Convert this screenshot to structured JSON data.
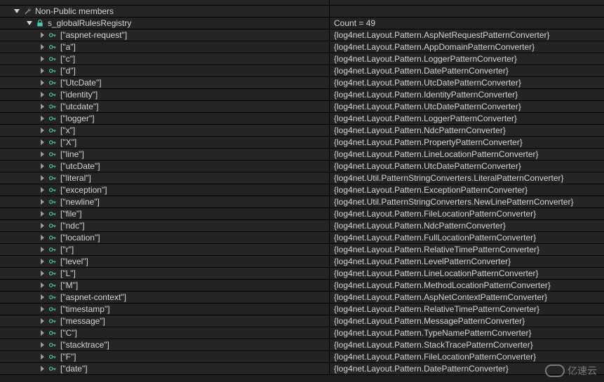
{
  "root": {
    "nonPublic": {
      "label": "Non-Public members",
      "registry": {
        "label": "s_globalRulesRegistry",
        "count_label": "Count = 49"
      }
    }
  },
  "entries": [
    {
      "key": "[\"aspnet-request\"]",
      "value": "{log4net.Layout.Pattern.AspNetRequestPatternConverter}"
    },
    {
      "key": "[\"a\"]",
      "value": "{log4net.Layout.Pattern.AppDomainPatternConverter}"
    },
    {
      "key": "[\"c\"]",
      "value": "{log4net.Layout.Pattern.LoggerPatternConverter}"
    },
    {
      "key": "[\"d\"]",
      "value": "{log4net.Layout.Pattern.DatePatternConverter}"
    },
    {
      "key": "[\"UtcDate\"]",
      "value": "{log4net.Layout.Pattern.UtcDatePatternConverter}"
    },
    {
      "key": "[\"identity\"]",
      "value": "{log4net.Layout.Pattern.IdentityPatternConverter}"
    },
    {
      "key": "[\"utcdate\"]",
      "value": "{log4net.Layout.Pattern.UtcDatePatternConverter}"
    },
    {
      "key": "[\"logger\"]",
      "value": "{log4net.Layout.Pattern.LoggerPatternConverter}"
    },
    {
      "key": "[\"x\"]",
      "value": "{log4net.Layout.Pattern.NdcPatternConverter}"
    },
    {
      "key": "[\"X\"]",
      "value": "{log4net.Layout.Pattern.PropertyPatternConverter}"
    },
    {
      "key": "[\"line\"]",
      "value": "{log4net.Layout.Pattern.LineLocationPatternConverter}"
    },
    {
      "key": "[\"utcDate\"]",
      "value": "{log4net.Layout.Pattern.UtcDatePatternConverter}"
    },
    {
      "key": "[\"literal\"]",
      "value": "{log4net.Util.PatternStringConverters.LiteralPatternConverter}"
    },
    {
      "key": "[\"exception\"]",
      "value": "{log4net.Layout.Pattern.ExceptionPatternConverter}"
    },
    {
      "key": "[\"newline\"]",
      "value": "{log4net.Util.PatternStringConverters.NewLinePatternConverter}"
    },
    {
      "key": "[\"file\"]",
      "value": "{log4net.Layout.Pattern.FileLocationPatternConverter}"
    },
    {
      "key": "[\"ndc\"]",
      "value": "{log4net.Layout.Pattern.NdcPatternConverter}"
    },
    {
      "key": "[\"location\"]",
      "value": "{log4net.Layout.Pattern.FullLocationPatternConverter}"
    },
    {
      "key": "[\"r\"]",
      "value": "{log4net.Layout.Pattern.RelativeTimePatternConverter}"
    },
    {
      "key": "[\"level\"]",
      "value": "{log4net.Layout.Pattern.LevelPatternConverter}"
    },
    {
      "key": "[\"L\"]",
      "value": "{log4net.Layout.Pattern.LineLocationPatternConverter}"
    },
    {
      "key": "[\"M\"]",
      "value": "{log4net.Layout.Pattern.MethodLocationPatternConverter}"
    },
    {
      "key": "[\"aspnet-context\"]",
      "value": "{log4net.Layout.Pattern.AspNetContextPatternConverter}"
    },
    {
      "key": "[\"timestamp\"]",
      "value": "{log4net.Layout.Pattern.RelativeTimePatternConverter}"
    },
    {
      "key": "[\"message\"]",
      "value": "{log4net.Layout.Pattern.MessagePatternConverter}"
    },
    {
      "key": "[\"C\"]",
      "value": "{log4net.Layout.Pattern.TypeNamePatternConverter}"
    },
    {
      "key": "[\"stacktrace\"]",
      "value": "{log4net.Layout.Pattern.StackTracePatternConverter}"
    },
    {
      "key": "[\"F\"]",
      "value": "{log4net.Layout.Pattern.FileLocationPatternConverter}"
    },
    {
      "key": "[\"date\"]",
      "value": "{log4net.Layout.Pattern.DatePatternConverter}"
    }
  ],
  "watermark": {
    "text": "亿速云"
  }
}
